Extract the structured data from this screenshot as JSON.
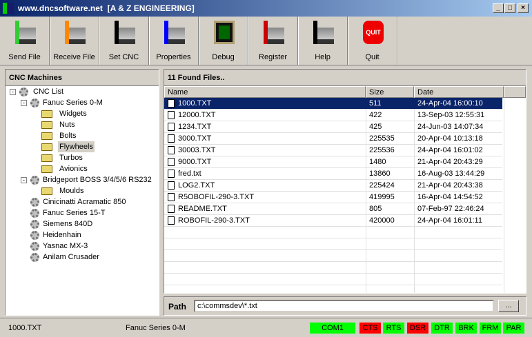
{
  "window": {
    "title": "www.dncsoftware.net  [A & Z ENGINEERING]",
    "min": "_",
    "max": "□",
    "close": "×"
  },
  "toolbar": [
    {
      "label": "Send File",
      "icon": "send-file-icon"
    },
    {
      "label": "Receive File",
      "icon": "receive-file-icon"
    },
    {
      "label": "Set CNC",
      "icon": "set-cnc-icon"
    },
    {
      "label": "Properties",
      "icon": "properties-icon"
    },
    {
      "label": "Debug",
      "icon": "debug-icon"
    },
    {
      "label": "Register",
      "icon": "register-icon"
    },
    {
      "label": "Help",
      "icon": "help-icon"
    },
    {
      "label": "Quit",
      "icon": "quit-icon",
      "icon_text": "QUIT"
    }
  ],
  "tree": {
    "title": "CNC Machines",
    "root": "CNC List",
    "nodes": [
      {
        "label": "Fanuc Series 0-M",
        "level": 1,
        "exp": "-"
      },
      {
        "label": "Widgets",
        "level": 2
      },
      {
        "label": "Nuts",
        "level": 2
      },
      {
        "label": "Bolts",
        "level": 2
      },
      {
        "label": "Flywheels",
        "level": 2,
        "selected": true
      },
      {
        "label": "Turbos",
        "level": 2
      },
      {
        "label": "Avionics",
        "level": 2
      },
      {
        "label": "Bridgeport BOSS 3/4/5/6 RS232",
        "level": 1,
        "exp": "-"
      },
      {
        "label": "Moulds",
        "level": 2
      },
      {
        "label": "Cinicinatti Acramatic 850",
        "level": 1
      },
      {
        "label": "Fanuc Series 15-T",
        "level": 1
      },
      {
        "label": "Siemens 840D",
        "level": 1
      },
      {
        "label": "Heidenhain",
        "level": 1
      },
      {
        "label": "Yasnac MX-3",
        "level": 1
      },
      {
        "label": "Anilam Crusader",
        "level": 1
      }
    ]
  },
  "files": {
    "title": "11 Found Files..",
    "columns": [
      "Name",
      "Size",
      "Date"
    ],
    "rows": [
      [
        "1000.TXT",
        "511",
        "24-Apr-04 16:00:10"
      ],
      [
        "12000.TXT",
        "422",
        "13-Sep-03 12:55:31"
      ],
      [
        "1234.TXT",
        "425",
        "24-Jun-03 14:07:34"
      ],
      [
        "3000.TXT",
        "225535",
        "20-Apr-04 10:13:18"
      ],
      [
        "30003.TXT",
        "225536",
        "24-Apr-04 16:01:02"
      ],
      [
        "9000.TXT",
        "1480",
        "21-Apr-04 20:43:29"
      ],
      [
        "fred.txt",
        "13860",
        "16-Aug-03 13:44:29"
      ],
      [
        "LOG2.TXT",
        "225424",
        "21-Apr-04 20:43:38"
      ],
      [
        "R5OBOFIL-290-3.TXT",
        "419995",
        "16-Apr-04 14:54:52"
      ],
      [
        "README.TXT",
        "805",
        "07-Feb-97 22:46:24"
      ],
      [
        "ROBOFIL-290-3.TXT",
        "420000",
        "24-Apr-04 16:01:11"
      ]
    ]
  },
  "path": {
    "label": "Path",
    "value": "c:\\commsdev\\*.txt",
    "browse": "..."
  },
  "status": {
    "file": "1000.TXT",
    "machine": "Fanuc Series 0-M",
    "port": "COM1",
    "signals": [
      {
        "label": "CTS",
        "color": "#ff0000"
      },
      {
        "label": "RTS",
        "color": "#00ff00"
      },
      {
        "label": "DSR",
        "color": "#ff0000"
      },
      {
        "label": "DTR",
        "color": "#00ff00"
      },
      {
        "label": "BRK",
        "color": "#00ff00"
      },
      {
        "label": "FRM",
        "color": "#00ff00"
      },
      {
        "label": "PAR",
        "color": "#00ff00"
      }
    ]
  }
}
